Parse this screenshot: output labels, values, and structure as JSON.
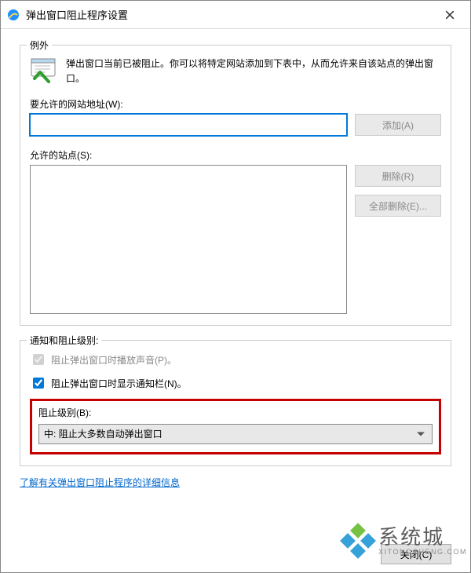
{
  "window": {
    "title": "弹出窗口阻止程序设置"
  },
  "exceptions": {
    "header": "例外",
    "info": "弹出窗口当前已被阻止。你可以将特定网站添加到下表中，从而允许来自该站点的弹出窗口。",
    "address_label": "要允许的网站地址(W):",
    "address_value": "",
    "add_btn": "添加(A)",
    "allowed_label": "允许的站点(S):",
    "remove_btn": "删除(R)",
    "remove_all_btn": "全部删除(E)..."
  },
  "notification": {
    "header": "通知和阻止级别:",
    "play_sound_label": "阻止弹出窗口时播放声音(P)。",
    "play_sound_checked": true,
    "play_sound_disabled": true,
    "show_bar_label": "阻止弹出窗口时显示通知栏(N)。",
    "show_bar_checked": true,
    "level_label": "阻止级别(B):",
    "level_value": "中: 阻止大多数自动弹出窗口"
  },
  "link_text": "了解有关弹出窗口阻止程序的详细信息",
  "close_btn": "关闭(C)",
  "watermark": {
    "main": "系统城",
    "sub": "XITONGCHENG.COM"
  },
  "colors": {
    "highlight_border": "#c40000",
    "accent": "#0078d7"
  }
}
